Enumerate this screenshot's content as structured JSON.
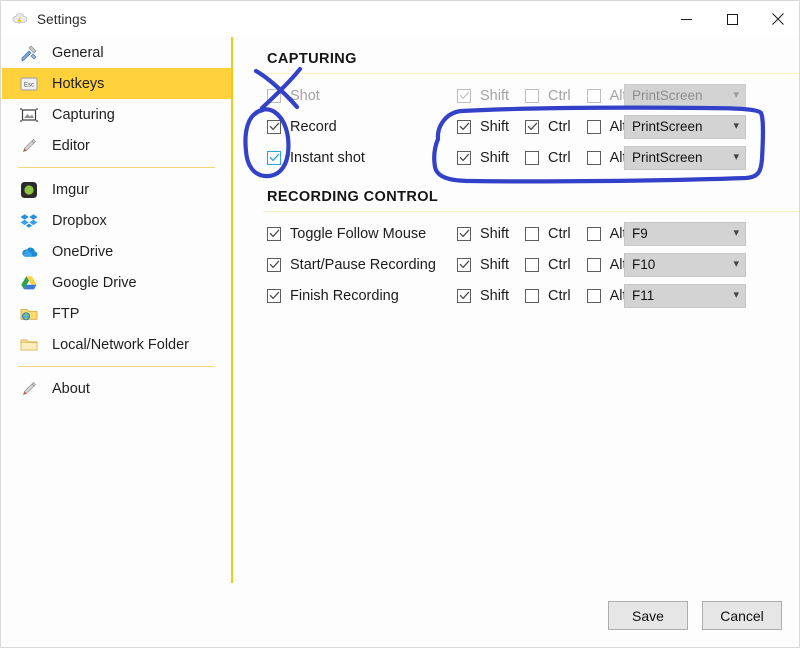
{
  "window": {
    "title": "Settings",
    "icon": "cloud-bolt-icon",
    "controls": {
      "minimize": "minimize-icon",
      "maximize": "maximize-icon",
      "close": "close-icon"
    }
  },
  "colors": {
    "accent_yellow": "#ffd23c",
    "divider_yellow": "#f3d77a",
    "rule_yellow": "#fbeec0",
    "annotation_blue": "#3341c8",
    "checkbox_blue": "#2da3e0",
    "combo_gray": "#d3d3d3",
    "button_gray": "#e6e6e6",
    "disabled_text": "#a3a3a3"
  },
  "sidebar": {
    "items": [
      {
        "label": "General",
        "icon": "tools-icon",
        "active": false
      },
      {
        "label": "Hotkeys",
        "icon": "esc-key-icon",
        "active": true
      },
      {
        "label": "Capturing",
        "icon": "capture-frame-icon",
        "active": false
      },
      {
        "label": "Editor",
        "icon": "pencil-icon",
        "active": false
      },
      {
        "label": "Imgur",
        "icon": "imgur-icon",
        "active": false
      },
      {
        "label": "Dropbox",
        "icon": "dropbox-icon",
        "active": false
      },
      {
        "label": "OneDrive",
        "icon": "onedrive-icon",
        "active": false
      },
      {
        "label": "Google Drive",
        "icon": "google-drive-icon",
        "active": false
      },
      {
        "label": "FTP",
        "icon": "ftp-folder-icon",
        "active": false
      },
      {
        "label": "Local/Network Folder",
        "icon": "folder-icon",
        "active": false
      },
      {
        "label": "About",
        "icon": "pencil-icon",
        "active": false
      }
    ],
    "separator_after_indexes": [
      3,
      9
    ]
  },
  "main": {
    "sections": [
      {
        "title": "CAPTURING",
        "rows": [
          {
            "name": "Shot",
            "enabled": false,
            "checked": false,
            "checkbox_style": "normal",
            "modifiers": [
              {
                "label": "Shift",
                "checked": true
              },
              {
                "label": "Ctrl",
                "checked": false
              },
              {
                "label": "Alt",
                "checked": false
              }
            ],
            "key": "PrintScreen"
          },
          {
            "name": "Record",
            "enabled": true,
            "checked": true,
            "checkbox_style": "normal",
            "modifiers": [
              {
                "label": "Shift",
                "checked": true
              },
              {
                "label": "Ctrl",
                "checked": true
              },
              {
                "label": "Alt",
                "checked": false
              }
            ],
            "key": "PrintScreen"
          },
          {
            "name": "Instant shot",
            "enabled": true,
            "checked": true,
            "checkbox_style": "blue",
            "modifiers": [
              {
                "label": "Shift",
                "checked": true
              },
              {
                "label": "Ctrl",
                "checked": false
              },
              {
                "label": "Alt",
                "checked": false
              }
            ],
            "key": "PrintScreen"
          }
        ]
      },
      {
        "title": "RECORDING CONTROL",
        "rows": [
          {
            "name": "Toggle Follow Mouse",
            "enabled": true,
            "checked": true,
            "checkbox_style": "normal",
            "modifiers": [
              {
                "label": "Shift",
                "checked": true
              },
              {
                "label": "Ctrl",
                "checked": false
              },
              {
                "label": "Alt",
                "checked": false
              }
            ],
            "key": "F9"
          },
          {
            "name": "Start/Pause Recording",
            "enabled": true,
            "checked": true,
            "checkbox_style": "normal",
            "modifiers": [
              {
                "label": "Shift",
                "checked": true
              },
              {
                "label": "Ctrl",
                "checked": false
              },
              {
                "label": "Alt",
                "checked": false
              }
            ],
            "key": "F10"
          },
          {
            "name": "Finish Recording",
            "enabled": true,
            "checked": true,
            "checkbox_style": "normal",
            "modifiers": [
              {
                "label": "Shift",
                "checked": true
              },
              {
                "label": "Ctrl",
                "checked": false
              },
              {
                "label": "Alt",
                "checked": false
              }
            ],
            "key": "F11"
          }
        ]
      }
    ]
  },
  "footer": {
    "save_label": "Save",
    "cancel_label": "Cancel"
  },
  "annotations": [
    {
      "name": "cross-out-shot-checkbox",
      "shape": "x-mark"
    },
    {
      "name": "circle-record-instantshot-checkboxes",
      "shape": "ellipse"
    },
    {
      "name": "rectangle-around-modifier-rows",
      "shape": "rounded-rect"
    }
  ]
}
